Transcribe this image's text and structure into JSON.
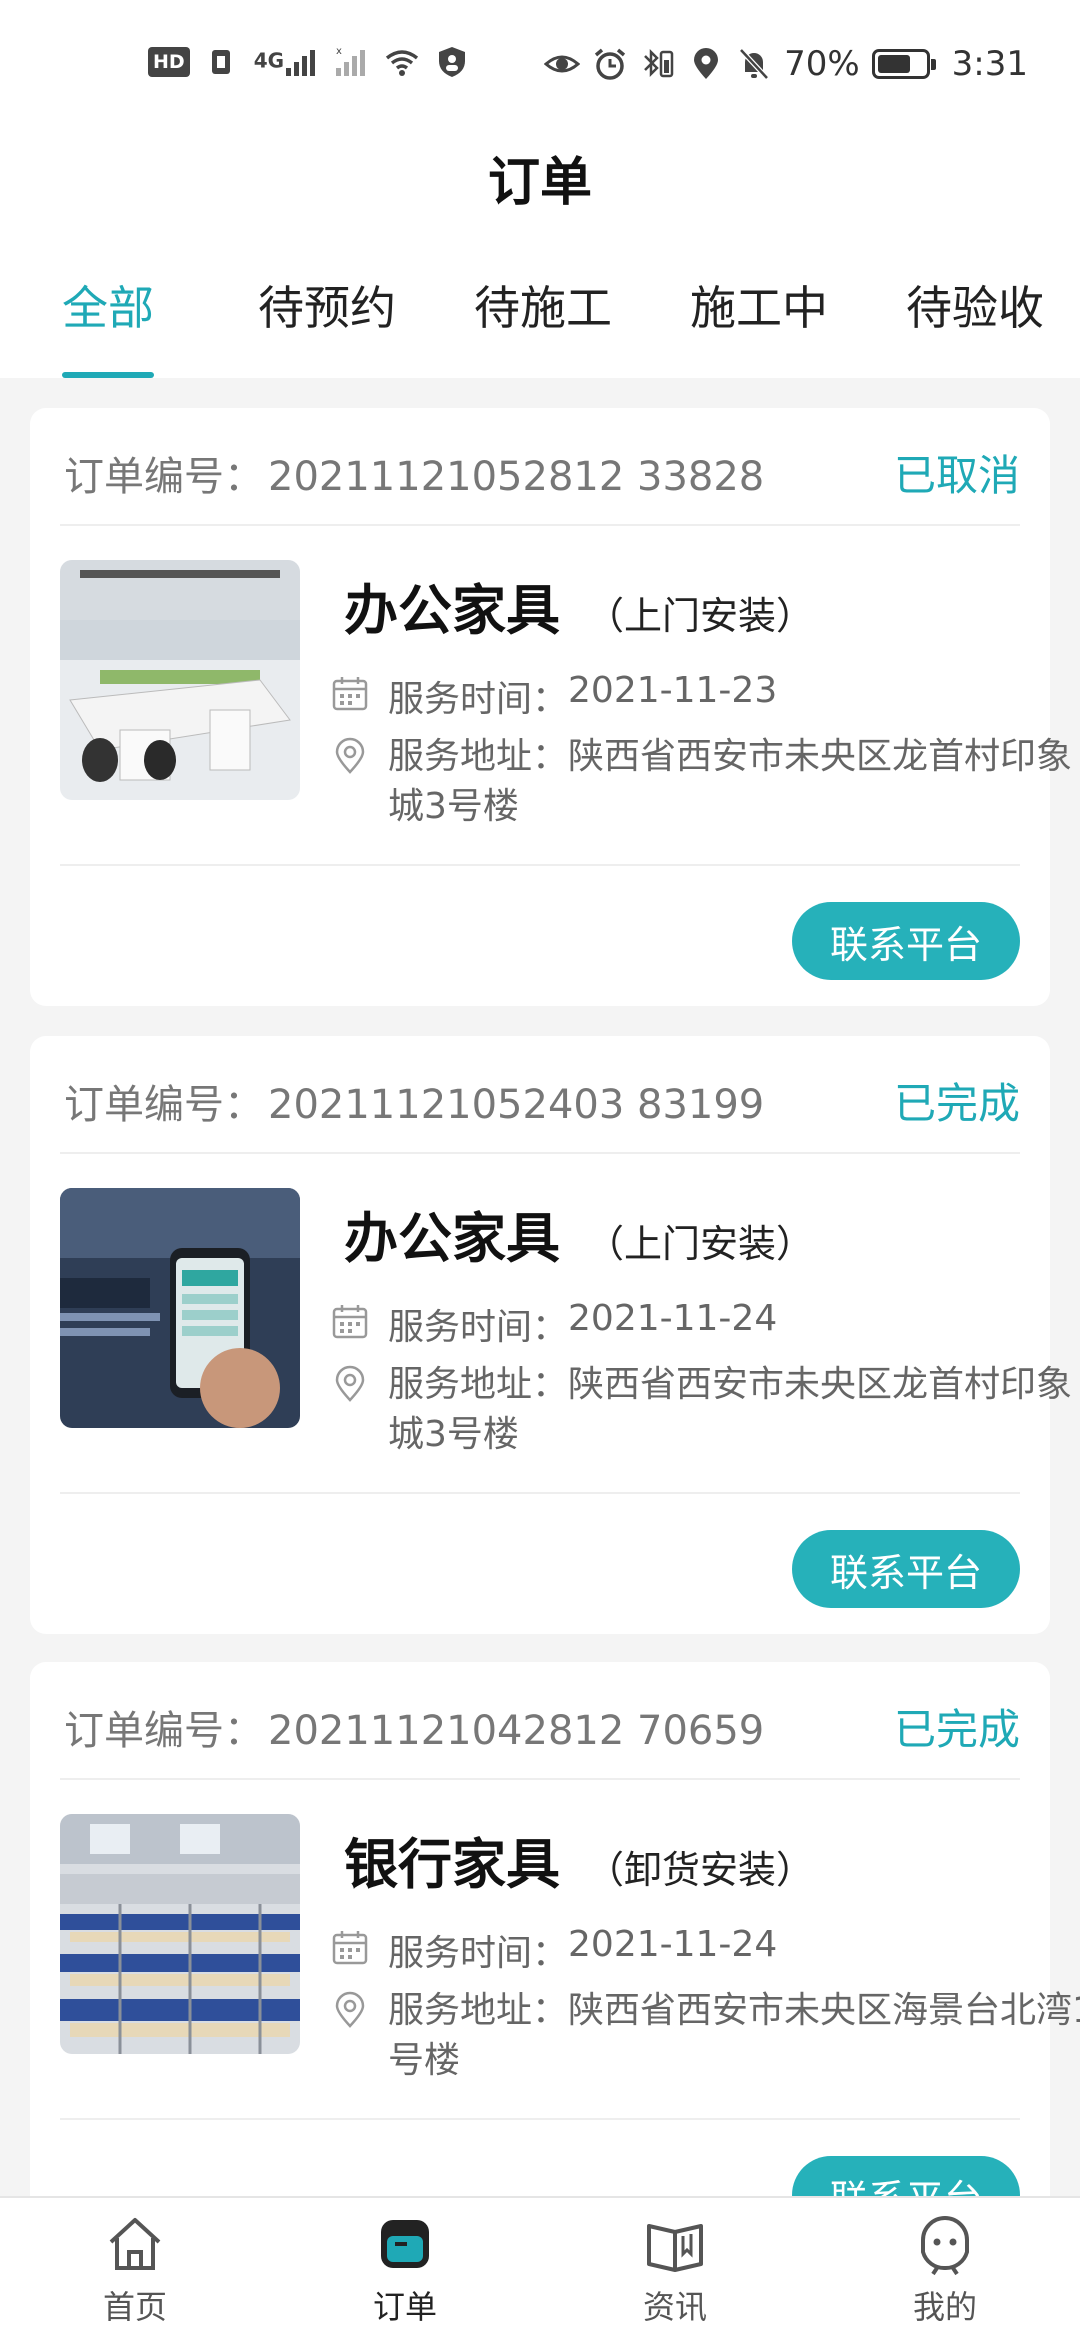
{
  "status_bar": {
    "left_icons": [
      "hd-icon",
      "sim-icon",
      "signal-4g-icon",
      "signal-empty-icon",
      "wifi-icon",
      "vpn-shield-icon"
    ],
    "hd_text": "HD",
    "net_text": "4G",
    "right_icons": [
      "eye-icon",
      "alarm-icon",
      "bluetooth-battery-icon",
      "location-icon",
      "mute-bell-icon"
    ],
    "battery_percent": "70%",
    "battery_level": 0.7,
    "time": "3:31"
  },
  "header": {
    "title": "订单"
  },
  "tabs": [
    {
      "label": "全部",
      "active": true
    },
    {
      "label": "待预约",
      "active": false
    },
    {
      "label": "待施工",
      "active": false
    },
    {
      "label": "施工中",
      "active": false
    },
    {
      "label": "待验收",
      "active": false
    }
  ],
  "orders": [
    {
      "order_label": "订单编号：",
      "order_no": "20211121052812 33828",
      "status": "已取消",
      "product": "办公家具",
      "service_type": "（上门安装）",
      "time_label": "服务时间：",
      "time_value": "2021-11-23",
      "addr_label": "服务地址：",
      "addr_value": "陕西省西安市未央区龙首村印象城3号楼",
      "button": "联系平台"
    },
    {
      "order_label": "订单编号：",
      "order_no": "20211121052403 83199",
      "status": "已完成",
      "product": "办公家具",
      "service_type": "（上门安装）",
      "time_label": "服务时间：",
      "time_value": "2021-11-24",
      "addr_label": "服务地址：",
      "addr_value": "陕西省西安市未央区龙首村印象城3号楼",
      "button": "联系平台"
    },
    {
      "order_label": "订单编号：",
      "order_no": "20211121042812 70659",
      "status": "已完成",
      "product": "银行家具",
      "service_type": "（卸货安装）",
      "time_label": "服务时间：",
      "time_value": "2021-11-24",
      "addr_label": "服务地址：",
      "addr_value": "陕西省西安市未央区海景台北湾1号楼",
      "button": "联系平台"
    }
  ],
  "bottom_nav": [
    {
      "label": "首页",
      "icon": "home-icon",
      "active": false
    },
    {
      "label": "订单",
      "icon": "order-icon",
      "active": true
    },
    {
      "label": "资讯",
      "icon": "news-book-icon",
      "active": false
    },
    {
      "label": "我的",
      "icon": "profile-icon",
      "active": false
    }
  ],
  "colors": {
    "accent": "#1fa9b6",
    "button": "#26b1ba",
    "background": "#f4f4f4"
  }
}
